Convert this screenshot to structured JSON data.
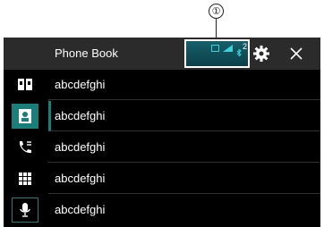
{
  "callout": {
    "number": "①"
  },
  "header": {
    "title": "Phone Book"
  },
  "status": {
    "device_count": "2"
  },
  "sidebar": {
    "items": [
      {
        "icon": "phone-book-icon"
      },
      {
        "icon": "contact-icon",
        "active": true
      },
      {
        "icon": "call-history-icon"
      },
      {
        "icon": "keypad-icon"
      },
      {
        "icon": "voice-recognition-icon"
      }
    ]
  },
  "contacts": {
    "items": [
      {
        "name": "abcdefghi"
      },
      {
        "name": "abcdefghi"
      },
      {
        "name": "abcdefghi"
      },
      {
        "name": "abcdefghi"
      },
      {
        "name": "abcdefghi"
      }
    ]
  },
  "colors": {
    "accent": "#1a7f7a",
    "header_bg": "#2b2b2b",
    "screen_bg": "#000000"
  }
}
